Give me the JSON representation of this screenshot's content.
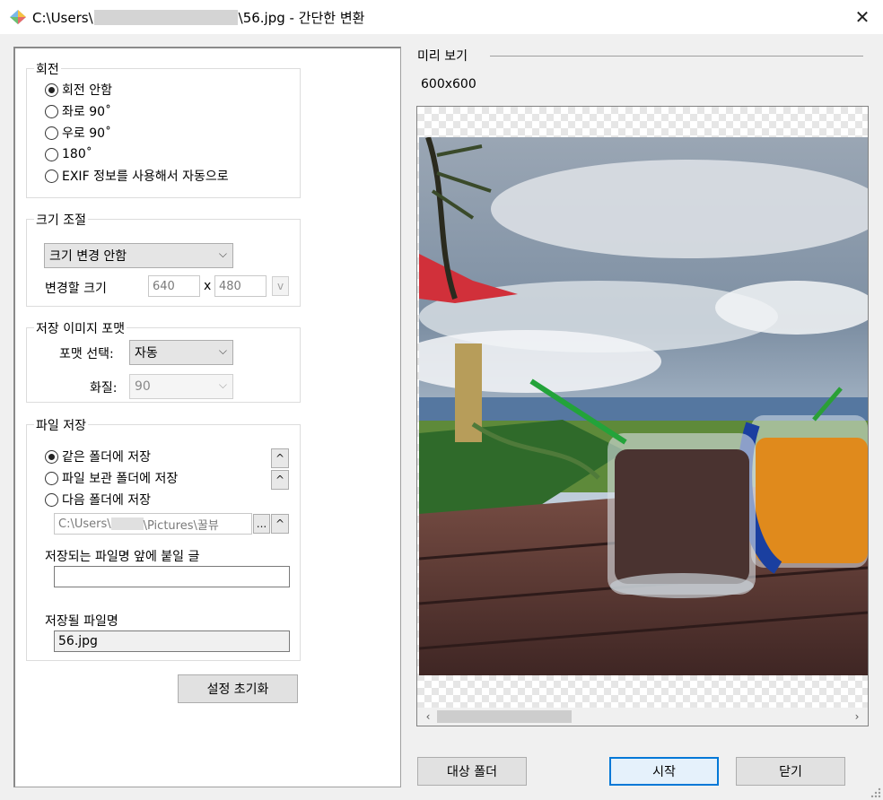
{
  "window": {
    "title_prefix": "C:\\Users\\",
    "title_suffix": "\\56.jpg - 간단한 변환",
    "close": "✕"
  },
  "rotation": {
    "title": "회전",
    "options": [
      "회전 안함",
      "좌로 90˚",
      "우로 90˚",
      "180˚",
      "EXIF 정보를 사용해서 자동으로"
    ],
    "selected_index": 0
  },
  "resize": {
    "title": "크기 조절",
    "mode": "크기 변경 안함",
    "size_label": "변경할 크기",
    "width": "640",
    "times": "x",
    "height": "480",
    "ratio_button": "v"
  },
  "format": {
    "title": "저장 이미지 포맷",
    "format_label": "포맷 선택:",
    "format_value": "자동",
    "quality_label": "화질:",
    "quality_value": "90"
  },
  "save": {
    "title": "파일 저장",
    "options": [
      "같은 폴더에 저장",
      "파일 보관 폴더에 저장",
      "다음 폴더에 저장"
    ],
    "selected_index": 0,
    "folder_path_prefix": "C:\\Users\\",
    "folder_path_suffix": "\\Pictures\\꿀뷰",
    "browse_button": "...",
    "up_glyph": "^",
    "prefix_label": "저장되는 파일명 앞에 붙일 글",
    "prefix_value": "",
    "filename_label": "저장될 파일명",
    "filename_value": "56.jpg"
  },
  "reset_button": "설정 초기화",
  "preview": {
    "title": "미리 보기",
    "size": "600x600"
  },
  "footer": {
    "target_folder": "대상 폴더",
    "start": "시작",
    "close": "닫기"
  },
  "icons": {
    "app": "app-diamond-icon",
    "close": "close-icon",
    "chevron": "chevron-down-icon",
    "scroll_left": "scroll-left-icon",
    "scroll_right": "scroll-right-icon"
  }
}
